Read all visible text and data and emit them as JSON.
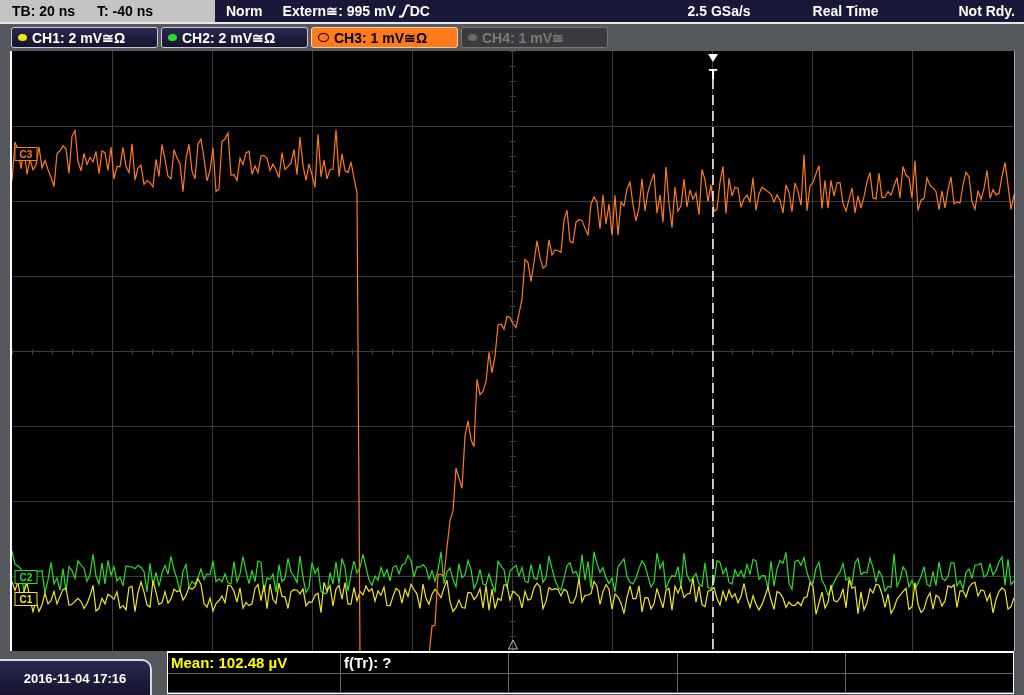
{
  "status_bar": {
    "timebase": "TB: 20 ns",
    "trigger_time": "T: -40 ns",
    "mode": "Norm",
    "trigger_source": "Extern≅: 995 mV",
    "trigger_coupling": "DC",
    "sample_rate": "2.5 GSa/s",
    "acquisition": "Real Time",
    "state": "Not Rdy."
  },
  "channels": [
    {
      "label": "CH1: 2 mV≅Ω",
      "color": "#f0e81e",
      "selected": false,
      "disabled": false
    },
    {
      "label": "CH2: 2 mV≅Ω",
      "color": "#28e028",
      "selected": false,
      "disabled": false
    },
    {
      "label": "CH3: 1 mV≅Ω",
      "color": "#ff7a1c",
      "selected": true,
      "disabled": false
    },
    {
      "label": "CH4: 1 mV≅",
      "color": "#6a6a6a",
      "selected": false,
      "disabled": true
    }
  ],
  "waveform_markers": [
    {
      "label": "C3",
      "color": "#ff7a1c"
    },
    {
      "label": "C2",
      "color": "#28e028"
    },
    {
      "label": "C1",
      "color": "#f0e81e"
    }
  ],
  "trigger_marker": "T",
  "date_time": "2016-11-04 17:16",
  "measurements": [
    {
      "text": "Mean: 102.48 µV",
      "color": "#ffff00"
    },
    {
      "text": "f(Tr): ?",
      "color": "#ffffff"
    }
  ]
}
